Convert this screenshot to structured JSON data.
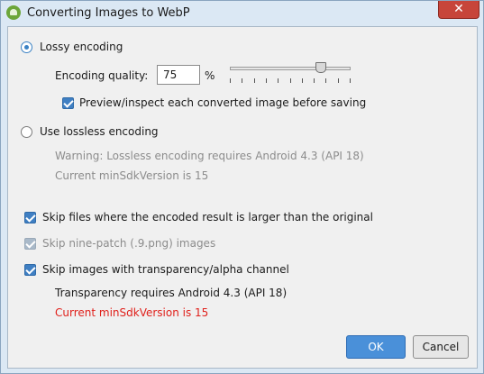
{
  "window": {
    "title": "Converting Images to WebP",
    "close_glyph": "✕"
  },
  "lossy": {
    "label": "Lossy encoding",
    "selected": true,
    "quality_label": "Encoding quality:",
    "quality_value": "75",
    "percent_sign": "%",
    "slider_value_percent": 75,
    "preview_label": "Preview/inspect each converted image before saving",
    "preview_checked": true
  },
  "lossless": {
    "label": "Use lossless encoding",
    "selected": false,
    "warning": "Warning: Lossless encoding requires Android 4.3 (API 18)",
    "min_sdk": "Current minSdkVersion is 15"
  },
  "options": {
    "skip_larger_label": "Skip files where the encoded result is larger than the original",
    "skip_ninepatch_label": "Skip nine-patch (.9.png) images",
    "skip_alpha_label": "Skip images with transparency/alpha channel",
    "alpha_requirement": "Transparency requires Android 4.3 (API 18)",
    "alpha_min_sdk": "Current minSdkVersion is 15"
  },
  "buttons": {
    "ok": "OK",
    "cancel": "Cancel"
  },
  "colors": {
    "accent": "#3f7fc3",
    "error": "#e0201b",
    "close": "#c7453a"
  }
}
